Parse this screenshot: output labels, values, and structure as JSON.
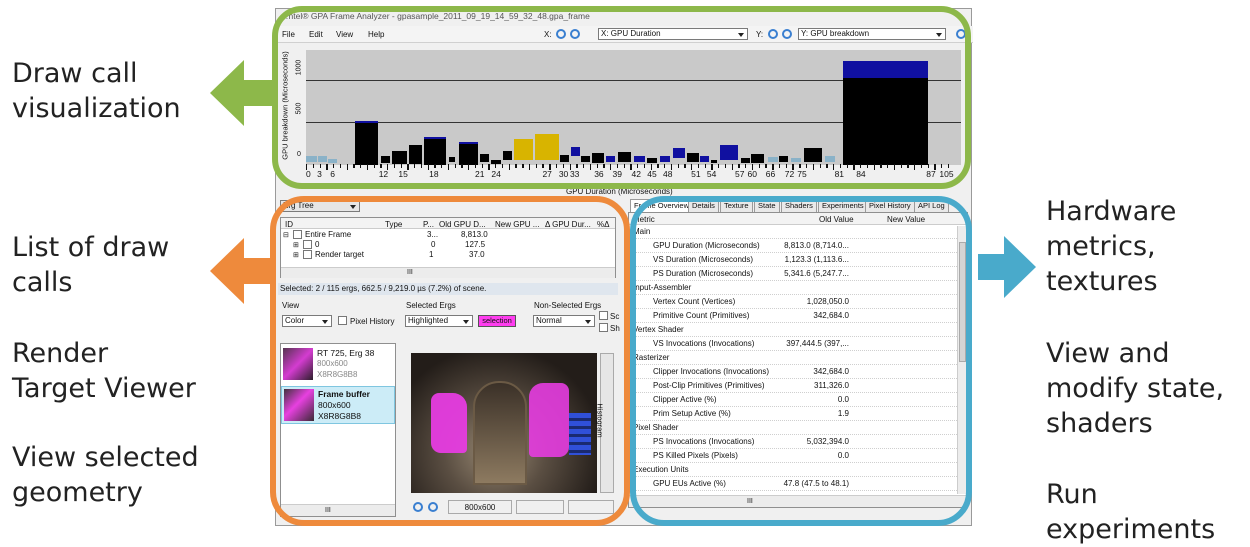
{
  "labels": {
    "draw_call": [
      "Draw call",
      "visualization"
    ],
    "list": [
      "List of draw",
      "calls"
    ],
    "rt": [
      "Render",
      "Target Viewer"
    ],
    "geom": [
      "View selected",
      "geometry"
    ],
    "hw": [
      "Hardware",
      "metrics,",
      "textures"
    ],
    "state": [
      "View and",
      "modify state,",
      "shaders"
    ],
    "exp": [
      "Run",
      "experiments"
    ]
  },
  "colors": {
    "green": "#8db84a",
    "orange": "#ee8a3c",
    "blue": "#49aacb"
  },
  "app": {
    "title": "…ntel® GPA Frame Analyzer - gpasample_2011_09_19_14_59_32_48.gpa_frame",
    "menu": [
      "File",
      "Edit",
      "View",
      "Help"
    ],
    "x_label": "X:",
    "x_select": "X: GPU Duration",
    "y_label": "Y:",
    "y_select": "Y: GPU breakdown"
  },
  "chart_data": {
    "type": "bar",
    "ylabel": "GPU breakdown (Microseconds)",
    "xlabel": "GPU Duration (Microseconds)",
    "y_ticks": [
      "0",
      "500",
      "1000"
    ],
    "ylim": [
      0,
      1350
    ],
    "x_ticks": [
      "0",
      "3",
      "6",
      "12",
      "15",
      "18",
      "21",
      "24",
      "27",
      "30",
      "33",
      "36",
      "39",
      "42",
      "45",
      "48",
      "51",
      "54",
      "57",
      "60",
      "66",
      "72",
      "75",
      "81",
      "84",
      "87",
      "105"
    ],
    "grid": true,
    "bars": [
      {
        "start": 0.0,
        "end": 0.017,
        "top": 100,
        "base": 35,
        "color": "#8ab2c8"
      },
      {
        "start": 0.018,
        "end": 0.032,
        "top": 100,
        "base": 35,
        "color": "#8ab2c8"
      },
      {
        "start": 0.034,
        "end": 0.047,
        "top": 70,
        "base": 20,
        "color": "#8ab2c8"
      },
      {
        "start": 0.075,
        "end": 0.11,
        "top": 520,
        "base": 0,
        "color": "#000000",
        "cap": 30
      },
      {
        "start": 0.114,
        "end": 0.128,
        "top": 110,
        "base": 20,
        "color": "#000000"
      },
      {
        "start": 0.132,
        "end": 0.154,
        "top": 170,
        "base": 10,
        "color": "#000000"
      },
      {
        "start": 0.158,
        "end": 0.177,
        "top": 230,
        "base": 10,
        "color": "#000000"
      },
      {
        "start": 0.18,
        "end": 0.214,
        "top": 330,
        "base": 0,
        "color": "#000000",
        "cap": 20
      },
      {
        "start": 0.218,
        "end": 0.228,
        "top": 90,
        "base": 30,
        "color": "#000000"
      },
      {
        "start": 0.234,
        "end": 0.262,
        "top": 270,
        "base": 0,
        "color": "#000000",
        "cap": 20
      },
      {
        "start": 0.266,
        "end": 0.28,
        "top": 130,
        "base": 30,
        "color": "#000000"
      },
      {
        "start": 0.282,
        "end": 0.297,
        "top": 60,
        "base": 10,
        "color": "#000000"
      },
      {
        "start": 0.3,
        "end": 0.315,
        "top": 160,
        "base": 60,
        "color": "#000000"
      },
      {
        "start": 0.318,
        "end": 0.347,
        "top": 300,
        "base": 60,
        "color": "#d8b400"
      },
      {
        "start": 0.35,
        "end": 0.386,
        "top": 360,
        "base": 60,
        "color": "#d8b400"
      },
      {
        "start": 0.388,
        "end": 0.402,
        "top": 120,
        "base": 30,
        "color": "#000000"
      },
      {
        "start": 0.404,
        "end": 0.418,
        "top": 210,
        "base": 110,
        "color": "#1010a0"
      },
      {
        "start": 0.42,
        "end": 0.433,
        "top": 100,
        "base": 30,
        "color": "#000000"
      },
      {
        "start": 0.436,
        "end": 0.455,
        "top": 140,
        "base": 20,
        "color": "#000000"
      },
      {
        "start": 0.458,
        "end": 0.472,
        "top": 110,
        "base": 40,
        "color": "#1010a0"
      },
      {
        "start": 0.476,
        "end": 0.496,
        "top": 150,
        "base": 30,
        "color": "#000000"
      },
      {
        "start": 0.5,
        "end": 0.517,
        "top": 110,
        "base": 40,
        "color": "#1010a0"
      },
      {
        "start": 0.52,
        "end": 0.536,
        "top": 80,
        "base": 20,
        "color": "#000000"
      },
      {
        "start": 0.54,
        "end": 0.556,
        "top": 110,
        "base": 30,
        "color": "#1010a0"
      },
      {
        "start": 0.56,
        "end": 0.578,
        "top": 200,
        "base": 80,
        "color": "#1010a0"
      },
      {
        "start": 0.582,
        "end": 0.6,
        "top": 140,
        "base": 30,
        "color": "#000000"
      },
      {
        "start": 0.602,
        "end": 0.616,
        "top": 100,
        "base": 30,
        "color": "#1010a0"
      },
      {
        "start": 0.618,
        "end": 0.628,
        "top": 60,
        "base": 20,
        "color": "#000000"
      },
      {
        "start": 0.632,
        "end": 0.66,
        "top": 240,
        "base": 60,
        "color": "#1010a0"
      },
      {
        "start": 0.664,
        "end": 0.678,
        "top": 80,
        "base": 20,
        "color": "#000000"
      },
      {
        "start": 0.68,
        "end": 0.7,
        "top": 130,
        "base": 20,
        "color": "#000000"
      },
      {
        "start": 0.705,
        "end": 0.72,
        "top": 90,
        "base": 30,
        "color": "#8ab2c8"
      },
      {
        "start": 0.722,
        "end": 0.736,
        "top": 100,
        "base": 30,
        "color": "#000000"
      },
      {
        "start": 0.74,
        "end": 0.756,
        "top": 80,
        "base": 30,
        "color": "#8ab2c8"
      },
      {
        "start": 0.76,
        "end": 0.788,
        "top": 200,
        "base": 30,
        "color": "#000000"
      },
      {
        "start": 0.792,
        "end": 0.808,
        "top": 100,
        "base": 30,
        "color": "#8ab2c8"
      },
      {
        "start": 0.82,
        "end": 0.95,
        "top": 1220,
        "base": 0,
        "color": "#000000",
        "cap": 200
      }
    ],
    "cap_color": "#1010a0"
  },
  "left_panel": {
    "dropdown": "Erg Tree",
    "columns": [
      "ID",
      "Type",
      "P...",
      "Old GPU D...",
      "New GPU ...",
      "Δ GPU Dur...",
      "%Δ"
    ],
    "rows": [
      {
        "name": "Entire Frame",
        "p": "3...",
        "old": "8,813.0"
      },
      {
        "name": "0",
        "p": "0",
        "old": "127.5"
      },
      {
        "name": "Render target",
        "p": "1",
        "old": "37.0"
      }
    ],
    "scroll_mark": "III",
    "status": "Selected: 2 / 115 ergs, 662.5 / 9,219.0 µs (7.2%) of scene.",
    "view_label": "View",
    "view_select": "Color",
    "pixel_history": "Pixel History",
    "sel_ergs_label": "Selected Ergs",
    "sel_ergs_select": "Highlighted",
    "selection_badge": "selection",
    "nonsel_label": "Non-Selected Ergs",
    "nonsel_select": "Normal",
    "sc": "Sc",
    "sh": "Sh",
    "thumbs": [
      {
        "title": "RT 725, Erg 38",
        "size": "800x600",
        "fmt": "X8R8G8B8"
      },
      {
        "title": "Frame buffer",
        "size": "800x600",
        "fmt": "X8R8G8B8"
      }
    ],
    "histogram": "Histogram",
    "zoom_size": "800x600"
  },
  "right_panel": {
    "tabs": [
      "Frame Overview",
      "Details",
      "Texture",
      "State",
      "Shaders",
      "Experiments",
      "Pixel History",
      "API Log"
    ],
    "col_metric": "Metric",
    "col_old": "Old Value",
    "col_new": "New Value",
    "rows": [
      {
        "name": "Main",
        "sec": true
      },
      {
        "name": "GPU Duration (Microseconds)",
        "old": "8,813.0 (8,714.0..."
      },
      {
        "name": "VS Duration (Microseconds)",
        "old": "1,123.3 (1,113.6..."
      },
      {
        "name": "PS Duration (Microseconds)",
        "old": "5,341.6 (5,247.7..."
      },
      {
        "name": "Input-Assembler",
        "sec": true
      },
      {
        "name": "Vertex Count (Vertices)",
        "old": "1,028,050.0"
      },
      {
        "name": "Primitive Count (Primitives)",
        "old": "342,684.0"
      },
      {
        "name": "Vertex Shader",
        "sec": true
      },
      {
        "name": "VS Invocations (Invocations)",
        "old": "397,444.5 (397,..."
      },
      {
        "name": "Rasterizer",
        "sec": true
      },
      {
        "name": "Clipper Invocations (Invocations)",
        "old": "342,684.0"
      },
      {
        "name": "Post-Clip Primitives (Primitives)",
        "old": "311,326.0"
      },
      {
        "name": "Clipper Active (%)",
        "old": "0.0"
      },
      {
        "name": "Prim Setup Active (%)",
        "old": "1.9"
      },
      {
        "name": "Pixel Shader",
        "sec": true
      },
      {
        "name": "PS Invocations (Invocations)",
        "old": "5,032,394.0"
      },
      {
        "name": "PS Killed Pixels (Pixels)",
        "old": "0.0"
      },
      {
        "name": "Execution Units",
        "sec": true
      },
      {
        "name": "GPU EUs Active (%)",
        "old": "47.8 (47.5 to 48.1)"
      }
    ],
    "scroll_mark": "III"
  }
}
